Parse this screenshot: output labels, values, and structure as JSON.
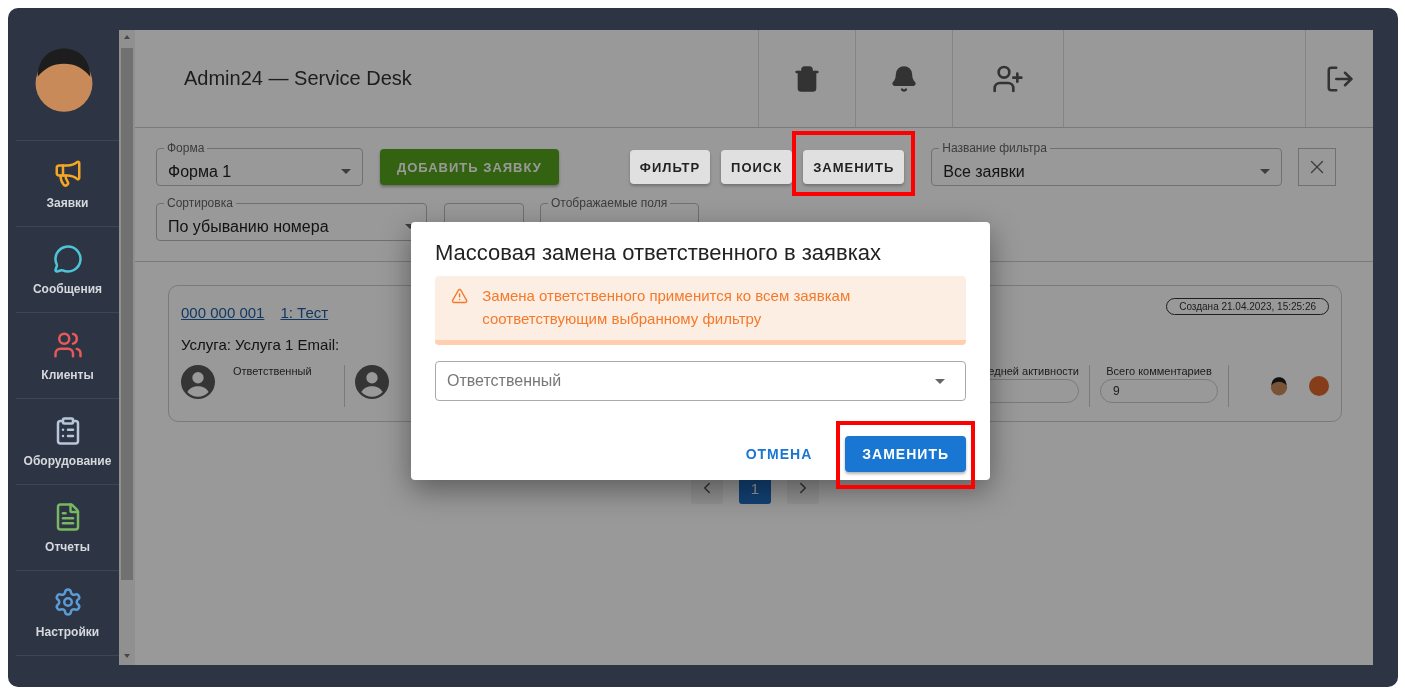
{
  "sidebar": {
    "items": [
      {
        "label": "Заявки"
      },
      {
        "label": "Сообщения"
      },
      {
        "label": "Клиенты"
      },
      {
        "label": "Оборудование"
      },
      {
        "label": "Отчеты"
      },
      {
        "label": "Настройки"
      }
    ]
  },
  "header": {
    "title": "Admin24 — Service Desk"
  },
  "toolbar": {
    "form_select": {
      "label": "Форма",
      "value": "Форма 1"
    },
    "add_button": "ДОБАВИТЬ ЗАЯВКУ",
    "buttons": [
      {
        "label": "ФИЛЬТР",
        "highlighted": false
      },
      {
        "label": "ПОИСК",
        "highlighted": false
      },
      {
        "label": "ЗАМЕНИТЬ",
        "highlighted": true
      }
    ],
    "filter_select": {
      "label": "Название фильтра",
      "value": "Все заявки"
    },
    "sort_select": {
      "label": "Сортировка",
      "value": "По убыванию номера"
    },
    "fields_select": {
      "label": "Отображаемые поля"
    }
  },
  "ticket": {
    "number": "000 000 001",
    "title": "1: Тест",
    "service": "Услуга: Услуга 1 Email:",
    "created": "Создана 21.04.2023, 15:25:26",
    "responsible_label": "Ответственный",
    "fields": [
      {
        "label": "едней активности"
      },
      {
        "label": "Всего комментариев",
        "value": "9"
      }
    ]
  },
  "pagination": {
    "pages": [
      {
        "label": "1",
        "selected": true
      }
    ]
  },
  "dialog": {
    "title": "Массовая замена ответственного в заявках",
    "warning": "Замена ответственного применится ко всем заявкам соответствующим выбранному фильтру",
    "select": {
      "placeholder": "Ответственный"
    },
    "buttons": [
      {
        "label": "ОТМЕНА",
        "kind": "text",
        "highlighted": false
      },
      {
        "label": "ЗАМЕНИТЬ",
        "kind": "contained",
        "highlighted": true
      }
    ]
  }
}
